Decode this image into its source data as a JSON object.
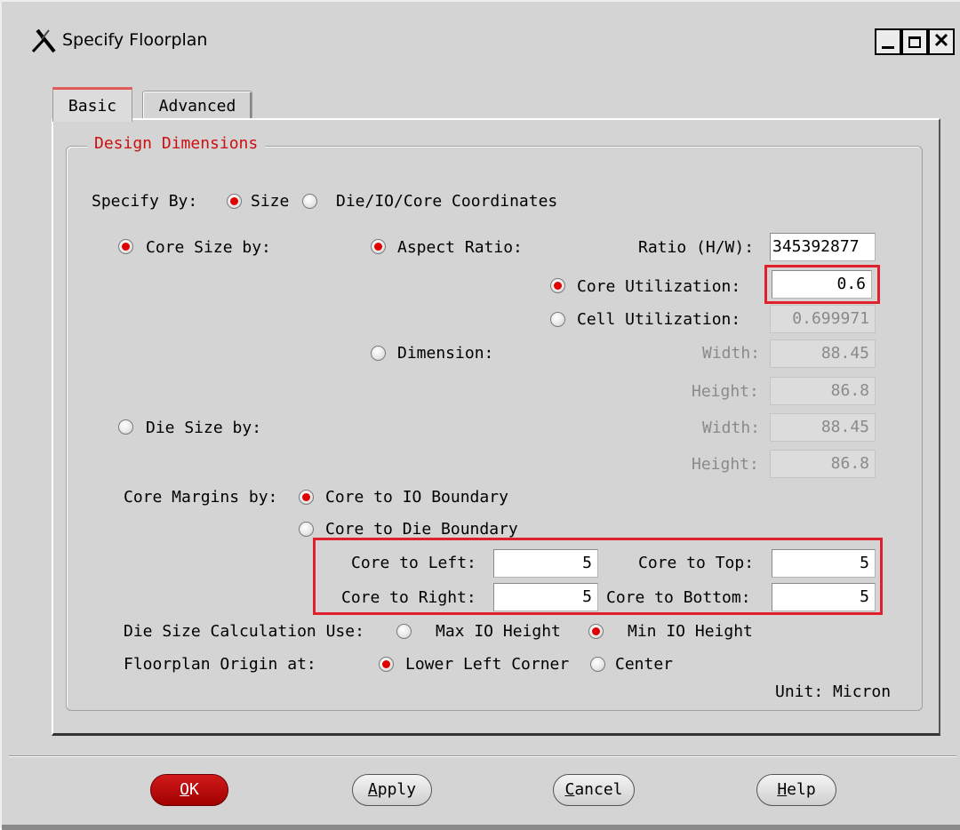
{
  "window": {
    "title": "Specify Floorplan",
    "icon": "x-logo-icon",
    "controls": [
      "minimize-icon",
      "maximize-icon",
      "close-icon"
    ]
  },
  "tabs": [
    {
      "label": "Basic",
      "active": true
    },
    {
      "label": "Advanced",
      "active": false
    }
  ],
  "group": {
    "title": "Design Dimensions",
    "title_color": "#cc1010"
  },
  "specify_by": {
    "label": "Specify By:",
    "options": [
      {
        "label": "Size",
        "selected": true
      },
      {
        "label": "Die/IO/Core Coordinates",
        "selected": false
      }
    ]
  },
  "core_size_by": {
    "label": "Core Size by:",
    "selected": true
  },
  "aspect_ratio": {
    "label": "Aspect Ratio:",
    "selected": true,
    "ratio_label": "Ratio (H/W):",
    "ratio_value": "345392877"
  },
  "core_utilization": {
    "label": "Core Utilization:",
    "selected": true,
    "value": "0.6"
  },
  "cell_utilization": {
    "label": "Cell Utilization:",
    "selected": false,
    "value": "0.699971"
  },
  "dimension": {
    "label": "Dimension:",
    "selected": false,
    "width_label": "Width:",
    "width_value": "88.45",
    "height_label": "Height:",
    "height_value": "86.8"
  },
  "die_size_by": {
    "label": "Die Size by:",
    "selected": false,
    "width_label": "Width:",
    "width_value": "88.45",
    "height_label": "Height:",
    "height_value": "86.8"
  },
  "core_margins": {
    "label": "Core Margins by:",
    "options": [
      {
        "label": "Core to IO Boundary",
        "selected": true
      },
      {
        "label": "Core to Die Boundary",
        "selected": false
      }
    ],
    "left_label": "Core to Left:",
    "left_value": "5",
    "top_label": "Core to Top:",
    "top_value": "5",
    "right_label": "Core to Right:",
    "right_value": "5",
    "bottom_label": "Core to Bottom:",
    "bottom_value": "5"
  },
  "die_size_calc": {
    "label": "Die Size Calculation Use:",
    "options": [
      {
        "label": "Max IO Height",
        "selected": false
      },
      {
        "label": "Min IO Height",
        "selected": true
      }
    ]
  },
  "origin": {
    "label": "Floorplan Origin at:",
    "options": [
      {
        "label": "Lower Left Corner",
        "selected": true
      },
      {
        "label": "Center",
        "selected": false
      }
    ]
  },
  "unit": "Unit: Micron",
  "buttons": {
    "ok": {
      "mnemonic": "O",
      "rest": "K"
    },
    "apply": {
      "mnemonic": "A",
      "rest": "pply"
    },
    "cancel": {
      "mnemonic": "C",
      "rest": "ancel"
    },
    "help": {
      "mnemonic": "H",
      "rest": "elp"
    }
  },
  "colors": {
    "accent_red": "#e00000",
    "highlight_box": "#e0202c",
    "window_bg": "#d4d4d4"
  }
}
